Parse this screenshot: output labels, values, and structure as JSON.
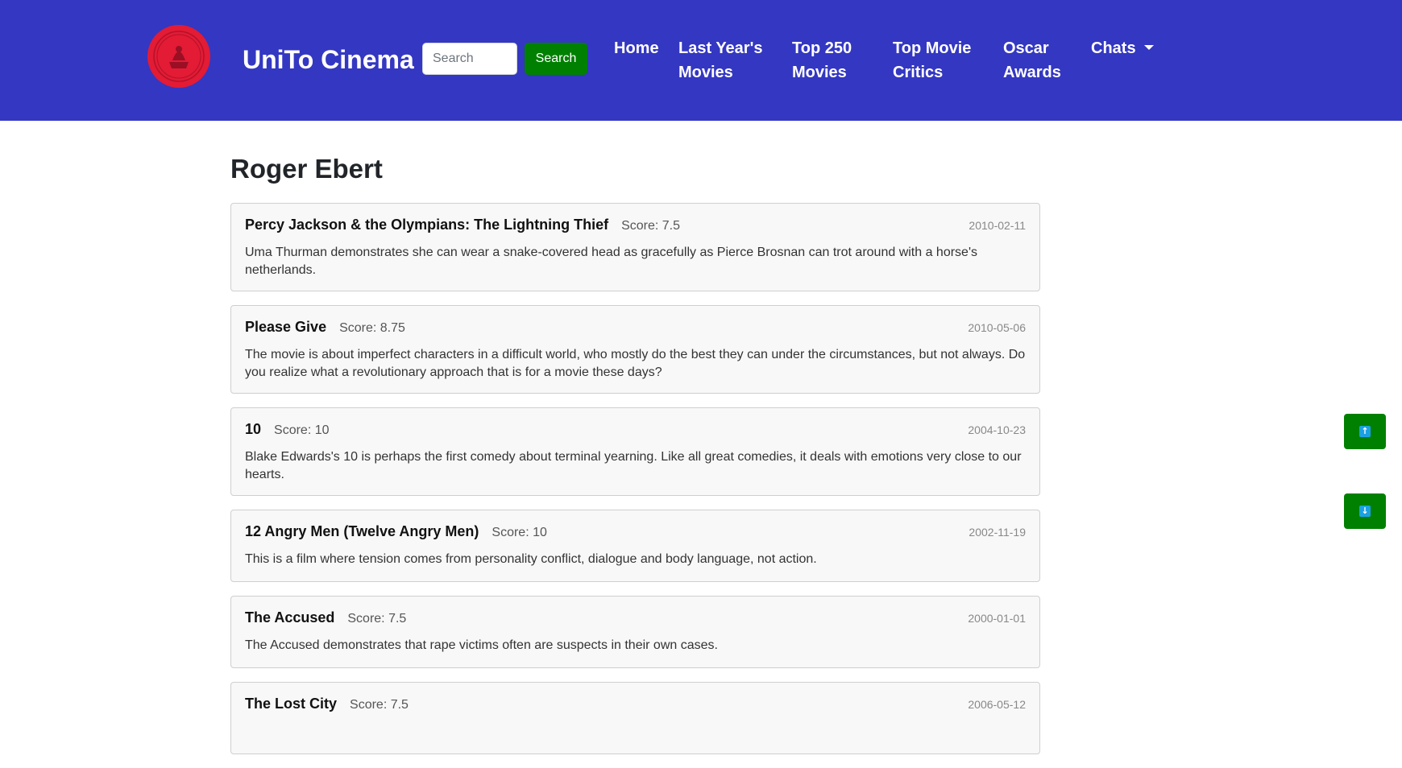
{
  "brand": {
    "name": "UniTo Cinema",
    "logo_icon": "unito-seal-icon",
    "logo_color": "#e31b35"
  },
  "search": {
    "placeholder": "Search",
    "value": "",
    "button_label": "Search"
  },
  "nav": {
    "home": "Home",
    "last_year": "Last Year's\nMovies",
    "top_250": "Top 250\nMovies",
    "top_critics": "Top Movie\nCritics",
    "oscar": "Oscar\nAwards",
    "chats": "Chats"
  },
  "colors": {
    "navbar": "#3437c1",
    "accent_green": "#008000",
    "card_bg": "#f8f8f8"
  },
  "page": {
    "title": "Roger Ebert"
  },
  "reviews": [
    {
      "title": "Percy Jackson & the Olympians: The Lightning Thief",
      "score": "Score: 7.5",
      "date": "2010-02-11",
      "text": "Uma Thurman demonstrates she can wear a snake-covered head as gracefully as Pierce Brosnan can trot around with a horse's netherlands."
    },
    {
      "title": "Please Give",
      "score": "Score: 8.75",
      "date": "2010-05-06",
      "text": "The movie is about imperfect characters in a difficult world, who mostly do the best they can under the circumstances, but not always. Do you realize what a revolutionary approach that is for a movie these days?"
    },
    {
      "title": "10",
      "score": "Score: 10",
      "date": "2004-10-23",
      "text": "Blake Edwards's 10 is perhaps the first comedy about terminal yearning. Like all great comedies, it deals with emotions very close to our hearts."
    },
    {
      "title": "12 Angry Men (Twelve Angry Men)",
      "score": "Score: 10",
      "date": "2002-11-19",
      "text": "This is a film where tension comes from personality conflict, dialogue and body language, not action."
    },
    {
      "title": "The Accused",
      "score": "Score: 7.5",
      "date": "2000-01-01",
      "text": "The Accused demonstrates that rape victims often are suspects in their own cases."
    },
    {
      "title": "The Lost City",
      "score": "Score: 7.5",
      "date": "2006-05-12",
      "text": ""
    }
  ],
  "scroll": {
    "up_icon": "arrow-up-icon",
    "down_icon": "arrow-down-icon"
  }
}
